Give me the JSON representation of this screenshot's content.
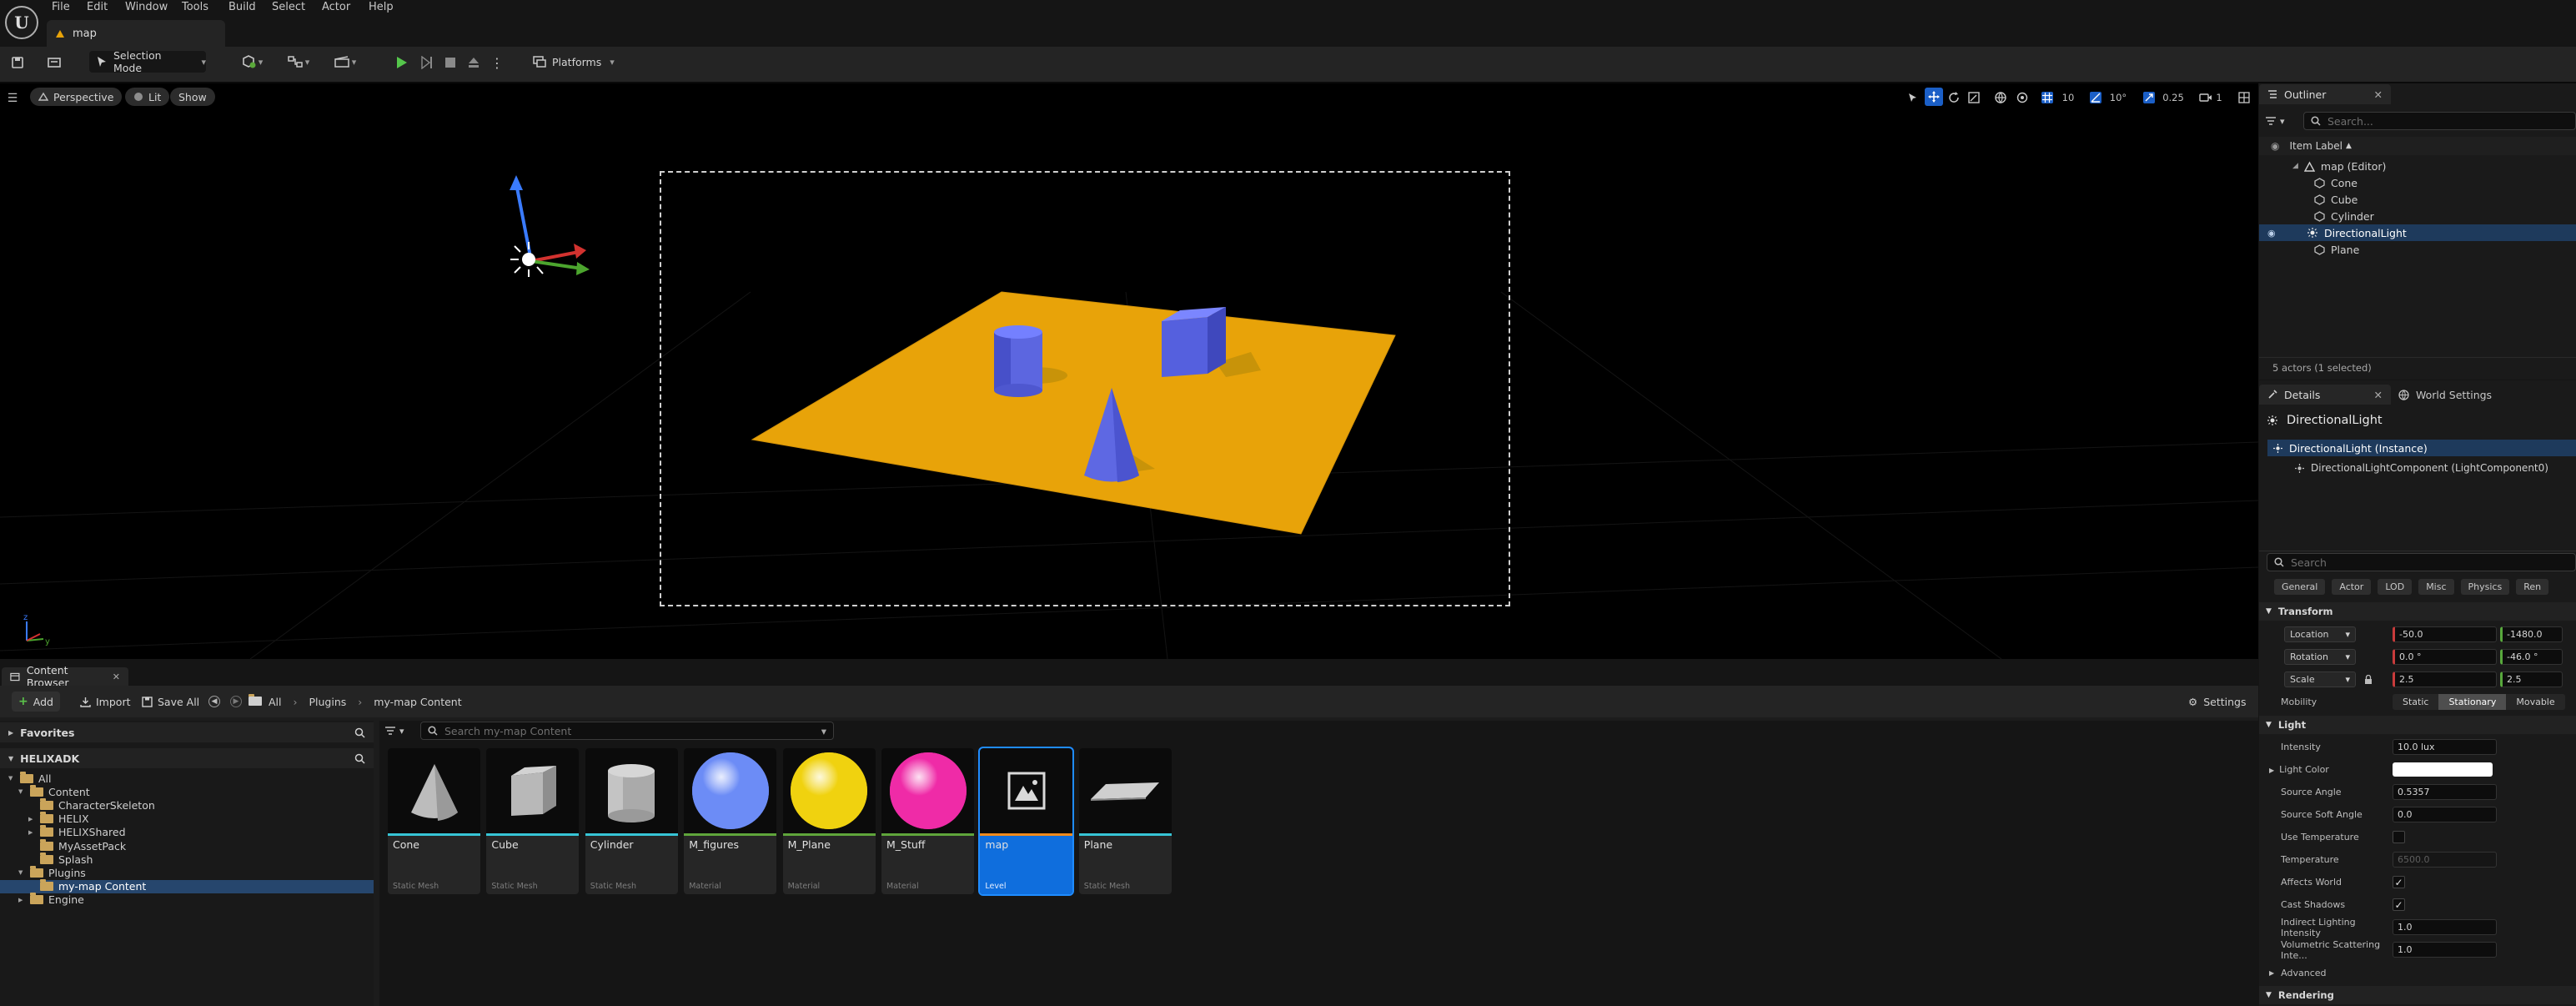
{
  "menubar": {
    "logo_text": "U",
    "items": [
      "File",
      "Edit",
      "Window",
      "Tools",
      "Build",
      "Select",
      "Actor",
      "Help"
    ],
    "doc_tab": "map"
  },
  "toolbar": {
    "selection_mode": "Selection Mode",
    "platforms": "Platforms"
  },
  "viewport": {
    "perspective": "Perspective",
    "lit": "Lit",
    "show": "Show",
    "grid_snap": "10",
    "rotation_snap": "10°",
    "scale_snap": "0.25",
    "camera_speed": "1",
    "colors": {
      "plane": "#e8a309",
      "shape": "#5c66e0",
      "frame": "#d0d0d0"
    }
  },
  "outliner": {
    "tab": "Outliner",
    "search_placeholder": "Search...",
    "column": "Item Label",
    "root": "map (Editor)",
    "items": [
      "Cone",
      "Cube",
      "Cylinder",
      "DirectionalLight",
      "Plane"
    ],
    "status": "5 actors (1 selected)"
  },
  "details": {
    "tab": "Details",
    "world_tab": "World Settings",
    "actor": "DirectionalLight",
    "instance": "DirectionalLight (Instance)",
    "component": "DirectionalLightComponent (LightComponent0)",
    "search_placeholder": "Search",
    "filters": [
      "General",
      "Actor",
      "LOD",
      "Misc",
      "Physics",
      "Ren"
    ],
    "transform_header": "Transform",
    "transform": [
      {
        "label": "Location",
        "x": "-50.0",
        "y": "-1480.0"
      },
      {
        "label": "Rotation",
        "x": "0.0 °",
        "y": "-46.0 °"
      },
      {
        "label": "Scale",
        "x": "2.5",
        "y": "2.5"
      }
    ],
    "mobility_label": "Mobility",
    "mobility": [
      "Static",
      "Stationary",
      "Movable"
    ],
    "light_header": "Light",
    "light": {
      "intensity_label": "Intensity",
      "intensity": "10.0 lux",
      "color_label": "Light Color",
      "source_angle_label": "Source Angle",
      "source_angle": "0.5357",
      "source_soft_angle_label": "Source Soft Angle",
      "source_soft_angle": "0.0",
      "use_temperature_label": "Use Temperature",
      "temperature_label": "Temperature",
      "temperature": "6500.0",
      "affects_world_label": "Affects World",
      "cast_shadows_label": "Cast Shadows",
      "indirect_label": "Indirect Lighting Intensity",
      "indirect": "1.0",
      "volumetric_label": "Volumetric Scattering Inte...",
      "volumetric": "1.0"
    },
    "advanced": "Advanced",
    "rendering": "Rendering"
  },
  "content_browser": {
    "tab": "Content Browser",
    "add": "Add",
    "import": "Import",
    "save_all": "Save All",
    "breadcrumb": [
      "All",
      "Plugins",
      "my-map Content"
    ],
    "settings": "Settings",
    "favorites": "Favorites",
    "project": "HELIXADK",
    "search_placeholder": "Search my-map Content",
    "tree": [
      {
        "label": "All",
        "depth": 0,
        "open": true
      },
      {
        "label": "Content",
        "depth": 1,
        "open": true
      },
      {
        "label": "CharacterSkeleton",
        "depth": 2
      },
      {
        "label": "HELIX",
        "depth": 2,
        "arrow": true
      },
      {
        "label": "HELIXShared",
        "depth": 2,
        "arrow": true
      },
      {
        "label": "MyAssetPack",
        "depth": 2
      },
      {
        "label": "Splash",
        "depth": 2
      },
      {
        "label": "Plugins",
        "depth": 1,
        "open": true
      },
      {
        "label": "my-map Content",
        "depth": 2,
        "selected": true
      },
      {
        "label": "Engine",
        "depth": 1,
        "arrow": true
      }
    ],
    "assets": [
      {
        "name": "Cone",
        "type": "Static Mesh",
        "icon": "cone-icon",
        "bar": "#37c5d6"
      },
      {
        "name": "Cube",
        "type": "Static Mesh",
        "icon": "cube-icon",
        "bar": "#37c5d6"
      },
      {
        "name": "Cylinder",
        "type": "Static Mesh",
        "icon": "cylinder-icon",
        "bar": "#37c5d6"
      },
      {
        "name": "M_figures",
        "type": "Material",
        "icon": "sphere-icon",
        "bar": "#5fa53b",
        "color": "#6c8cf6"
      },
      {
        "name": "M_Plane",
        "type": "Material",
        "icon": "sphere-icon",
        "bar": "#5fa53b",
        "color": "#f0d20f"
      },
      {
        "name": "M_Stuff",
        "type": "Material",
        "icon": "sphere-icon",
        "bar": "#5fa53b",
        "color": "#ef2ba7"
      },
      {
        "name": "map",
        "type": "Level",
        "icon": "level-icon",
        "bar": "#f08a1c",
        "selected": true
      },
      {
        "name": "Plane",
        "type": "Static Mesh",
        "icon": "plane-icon",
        "bar": "#37c5d6"
      }
    ]
  }
}
